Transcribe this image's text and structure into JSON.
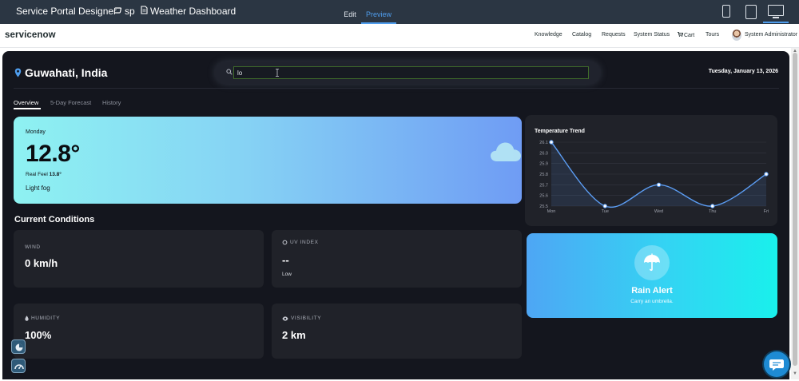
{
  "designer": {
    "title": "Service Portal Designer",
    "crumb_portal": "sp",
    "crumb_page": "Weather Dashboard",
    "tabs": [
      "Edit",
      "Preview"
    ],
    "active_tab": "Preview",
    "devices": [
      "phone-icon",
      "tablet-icon",
      "desktop-icon"
    ],
    "active_device": "desktop-icon"
  },
  "portal_header": {
    "logo": "servicenow",
    "nav": [
      "Knowledge",
      "Catalog",
      "Requests",
      "System Status",
      "Cart",
      "Tours"
    ],
    "user": "System Administrator"
  },
  "dashboard": {
    "location": "Guwahati, India",
    "search": {
      "value": "lo",
      "placeholder": ""
    },
    "date": "Tuesday, January 13, 2026",
    "tabs": [
      "Overview",
      "5-Day Forecast",
      "History"
    ],
    "active_tab": "Overview",
    "current": {
      "day": "Monday",
      "temp": "12.8°",
      "real_feel_label": "Real Feel",
      "real_feel_value": "13.8°",
      "description": "Light fog"
    },
    "conditions_title": "Current Conditions",
    "conditions": {
      "wind": {
        "label": "WIND",
        "value": "0 km/h"
      },
      "uv": {
        "label": "UV INDEX",
        "value": "--",
        "sub": "Low"
      },
      "humidity": {
        "label": "HUMIDITY",
        "value": "100%"
      },
      "visibility": {
        "label": "VISIBILITY",
        "value": "2 km"
      }
    },
    "rain_alert": {
      "title": "Rain Alert",
      "message": "Carry an umbrella."
    }
  },
  "colors": {
    "designer_bar": "#2b3643",
    "accent_blue": "#4f9ded",
    "app_bg": "#14161e",
    "card_bg": "#202229",
    "chart_line": "#5b9cf2"
  },
  "chart_data": {
    "type": "line",
    "title": "Temperature Trend",
    "categories": [
      "Mon",
      "Tue",
      "Wed",
      "Thu",
      "Fri"
    ],
    "series": [
      {
        "values": [
          26.1,
          25.5,
          25.7,
          25.5,
          25.8
        ]
      }
    ],
    "yticks": [
      25.5,
      25.6,
      25.7,
      25.8,
      25.9,
      26.0,
      26.1
    ],
    "ylim": [
      25.5,
      26.1
    ],
    "grid": true,
    "legend": "none"
  }
}
